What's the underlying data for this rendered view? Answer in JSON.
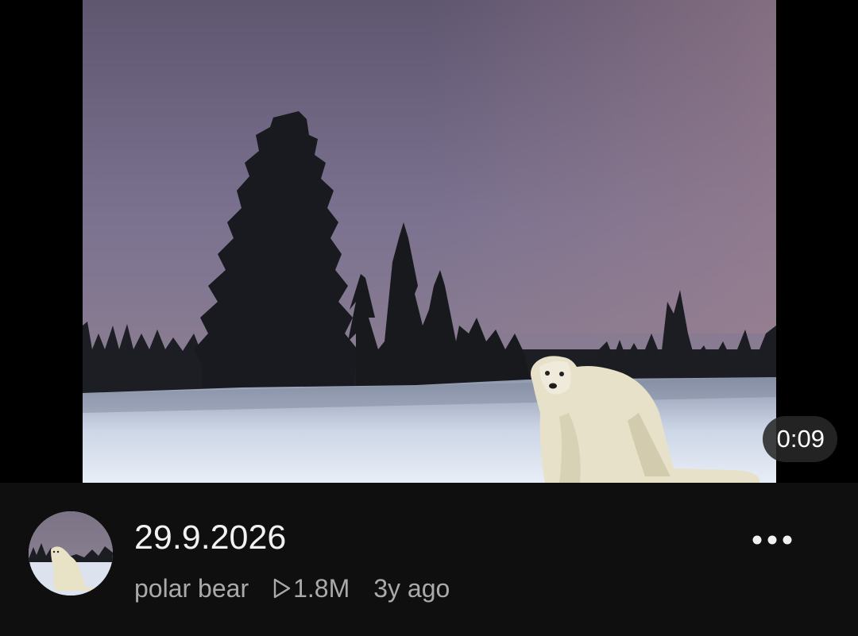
{
  "video": {
    "duration": "0:09"
  },
  "details": {
    "title": "29.9.2026",
    "channel": "polar bear",
    "views": "1.8M",
    "age": "3y ago"
  },
  "icons": {
    "more": "more-vertical-dots-icon",
    "views": "play-triangle-icon"
  },
  "colors": {
    "background": "#0f0f0f",
    "title": "#f1f1f1",
    "meta": "#aaaaaa"
  }
}
